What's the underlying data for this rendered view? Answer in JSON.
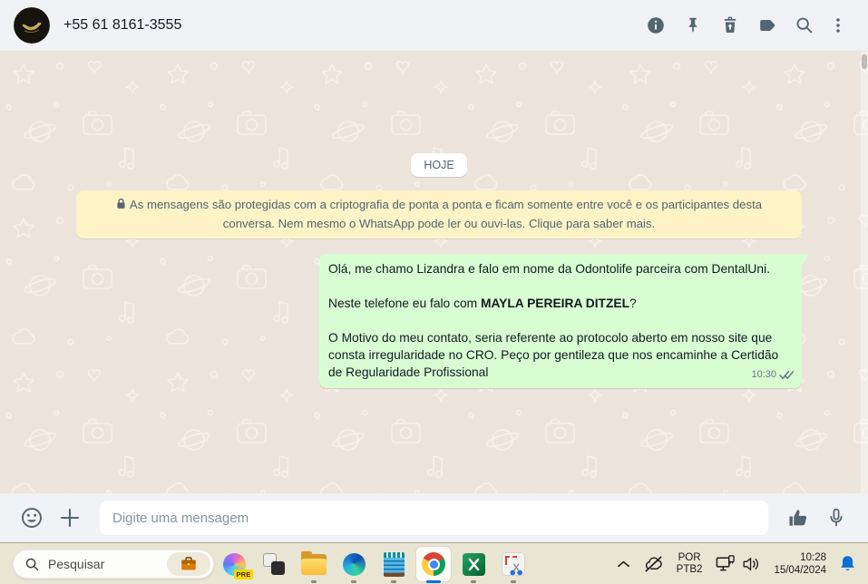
{
  "header": {
    "phone": "+55 61 8161-3555",
    "icons": [
      "info-icon",
      "pin-icon",
      "delete-icon",
      "label-icon",
      "search-icon",
      "menu-kebab-icon"
    ]
  },
  "chat": {
    "date_badge": "HOJE",
    "encryption_notice": "As mensagens são protegidas com a criptografia de ponta a ponta e ficam somente entre você e os participantes desta conversa. Nem mesmo o WhatsApp pode ler ou ouvi-las. Clique para saber mais.",
    "message": {
      "p1": "Olá, me chamo Lizandra e falo em nome da Odontolife parceira com DentalUni.",
      "p2_prefix": "Neste telefone eu falo com ",
      "p2_bold": "MAYLA PEREIRA DITZEL",
      "p2_suffix": "?",
      "p3": "O Motivo do meu contato, seria referente ao protocolo aberto em nosso site que consta irregularidade no CRO. Peço por gentileza que nos encaminhe a Certidão de Regularidade Profissional",
      "time": "10:30",
      "ticks": "double-gray"
    }
  },
  "composer": {
    "placeholder": "Digite uma mensagem",
    "icons": [
      "emoji-icon",
      "plus-icon",
      "thumbs-up-icon",
      "microphone-icon"
    ]
  },
  "taskbar": {
    "search_placeholder": "Pesquisar",
    "copilot_badge": "PRE",
    "apps": [
      "copilot",
      "task-view",
      "file-explorer",
      "edge",
      "notepad",
      "chrome",
      "excel",
      "snipping-tool"
    ],
    "active_app": "chrome",
    "running_apps": [
      "file-explorer",
      "edge",
      "notepad",
      "chrome",
      "excel",
      "snipping-tool"
    ]
  },
  "tray": {
    "language": {
      "line1": "POR",
      "line2": "PTB2"
    },
    "time": "10:28",
    "date": "15/04/2024",
    "icons": [
      "chevron-up-icon",
      "onedrive-off-icon",
      "network-icon",
      "volume-icon",
      "notification-bell-icon"
    ]
  },
  "colors": {
    "header_bg": "#f0f2f5",
    "chat_bg": "#ece5dc",
    "bubble_green": "#d9fdd3",
    "banner_yellow": "#fdf3c7",
    "icon_slate": "#54656f",
    "meta_gray": "#667781",
    "taskbar_bg": "#e9e5d3",
    "active_indicator_blue": "#0b72d8",
    "bell_blue": "#0b6fd4"
  }
}
